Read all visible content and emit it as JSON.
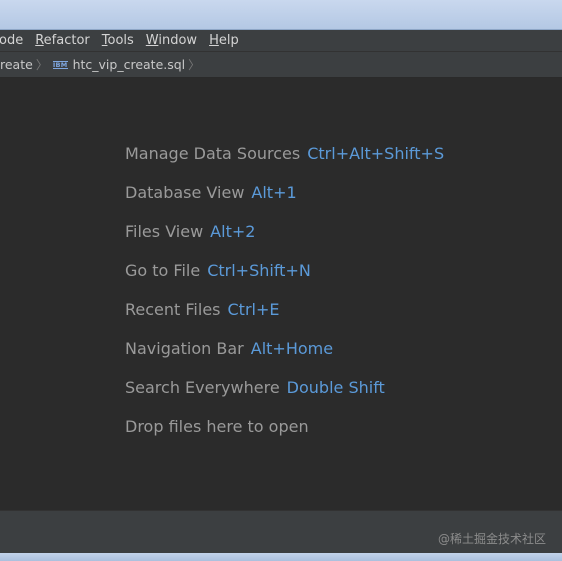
{
  "menu": {
    "items": [
      {
        "mnemonic": "",
        "label": "ode"
      },
      {
        "mnemonic": "R",
        "label": "efactor"
      },
      {
        "mnemonic": "T",
        "label": "ools"
      },
      {
        "mnemonic": "W",
        "label": "indow"
      },
      {
        "mnemonic": "H",
        "label": "elp"
      }
    ]
  },
  "breadcrumb": {
    "parent": "reate",
    "file_icon": "IBM",
    "file": "htc_vip_create.sql"
  },
  "welcome": {
    "hints": [
      {
        "label": "Manage Data Sources",
        "shortcut": "Ctrl+Alt+Shift+S"
      },
      {
        "label": "Database View",
        "shortcut": "Alt+1"
      },
      {
        "label": "Files View",
        "shortcut": "Alt+2"
      },
      {
        "label": "Go to File",
        "shortcut": "Ctrl+Shift+N"
      },
      {
        "label": "Recent Files",
        "shortcut": "Ctrl+E"
      },
      {
        "label": "Navigation Bar",
        "shortcut": "Alt+Home"
      },
      {
        "label": "Search Everywhere",
        "shortcut": "Double Shift"
      },
      {
        "label": "Drop files here to open",
        "shortcut": ""
      }
    ]
  },
  "watermark": "@稀土掘金技术社区",
  "colors": {
    "editor_bg": "#2b2b2b",
    "panel_bg": "#3c3f41",
    "hint_text": "#9a9a9a",
    "shortcut_text": "#5b9ad9"
  }
}
